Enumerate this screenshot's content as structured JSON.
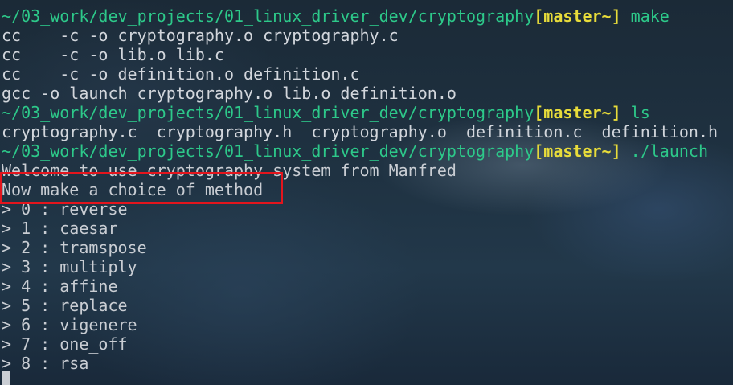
{
  "terminal": {
    "prompt_path": "~/03_work/dev_projects/01_linux_driver_dev/cryptography",
    "prompt_branch": "[master~]",
    "commands": {
      "make": " make",
      "ls": " ls",
      "launch": " ./launch"
    },
    "make_output": [
      "cc    -c -o cryptography.o cryptography.c",
      "cc    -c -o lib.o lib.c",
      "cc    -c -o definition.o definition.c",
      "gcc -o launch cryptography.o lib.o definition.o"
    ],
    "ls_output": "cryptography.c  cryptography.h  cryptography.o  definition.c  definition.h",
    "launch_output": {
      "welcome": "Welcome to use cryptography system from Manfred",
      "choice_prompt": "Now make a choice of method",
      "methods": [
        "> 0 : reverse",
        "> 1 : caesar",
        "> 2 : tramspose",
        "> 3 : multiply",
        "> 4 : affine",
        "> 5 : replace",
        "> 6 : vigenere",
        "> 7 : one_off",
        "> 8 : rsa"
      ]
    }
  },
  "colors": {
    "path": "#2dc98a",
    "branch": "#e8dc3a",
    "text": "#d2d6dc",
    "highlight_box": "#e3151d"
  }
}
